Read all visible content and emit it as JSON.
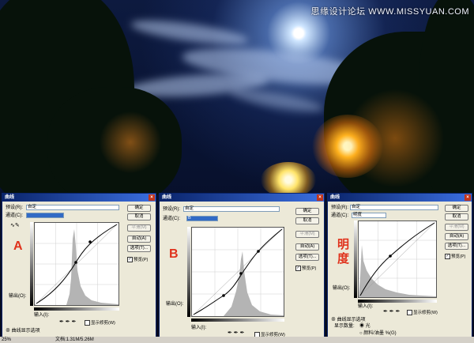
{
  "watermark": "思缘设计论坛  WWW.MISSYUAN.COM",
  "dialogs": [
    {
      "id": "A",
      "title": "曲线",
      "preset_label": "预设(R):",
      "preset_value": "自定",
      "channel_label": "通道(C):",
      "channel_value": "",
      "output_label": "输出(O):",
      "input_label": "输入(I):",
      "annotation": "A",
      "buttons": [
        "确定",
        "取消",
        "平滑(M)",
        "自动(A)",
        "选项(T)..."
      ],
      "preview_label": "预览(P)",
      "show_clipping": "显示修剪(W)",
      "curve_options": "曲线显示选项"
    },
    {
      "id": "B",
      "title": "曲线",
      "preset_label": "预设(R):",
      "preset_value": "自定",
      "channel_label": "通道(C):",
      "channel_value": "B",
      "output_label": "输出(O):",
      "input_label": "输入(I):",
      "annotation": "B",
      "buttons": [
        "确定",
        "取消",
        "平滑(M)",
        "自动(A)",
        "选项(T)..."
      ],
      "preview_label": "预览(P)",
      "show_clipping": "显示修剪(W)"
    },
    {
      "id": "C",
      "title": "曲线",
      "preset_label": "预设(R):",
      "preset_value": "自定",
      "channel_label": "通道(C):",
      "channel_value": "明度",
      "output_label": "输出(O):",
      "input_label": "输入(I):",
      "annotation": "明度",
      "buttons": [
        "确定",
        "取消",
        "平滑(M)",
        "自动(A)",
        "选项(T)..."
      ],
      "preview_label": "预览(P)",
      "show_clipping": "显示修剪(W)",
      "curve_options": "曲线显示选项",
      "show_amount": "显示数量:",
      "light_option": "光",
      "pigment_option": "颜料/油墨 %(G)"
    }
  ],
  "status": {
    "zoom": "25%",
    "doc": "文档:1.31M/5.26M"
  }
}
